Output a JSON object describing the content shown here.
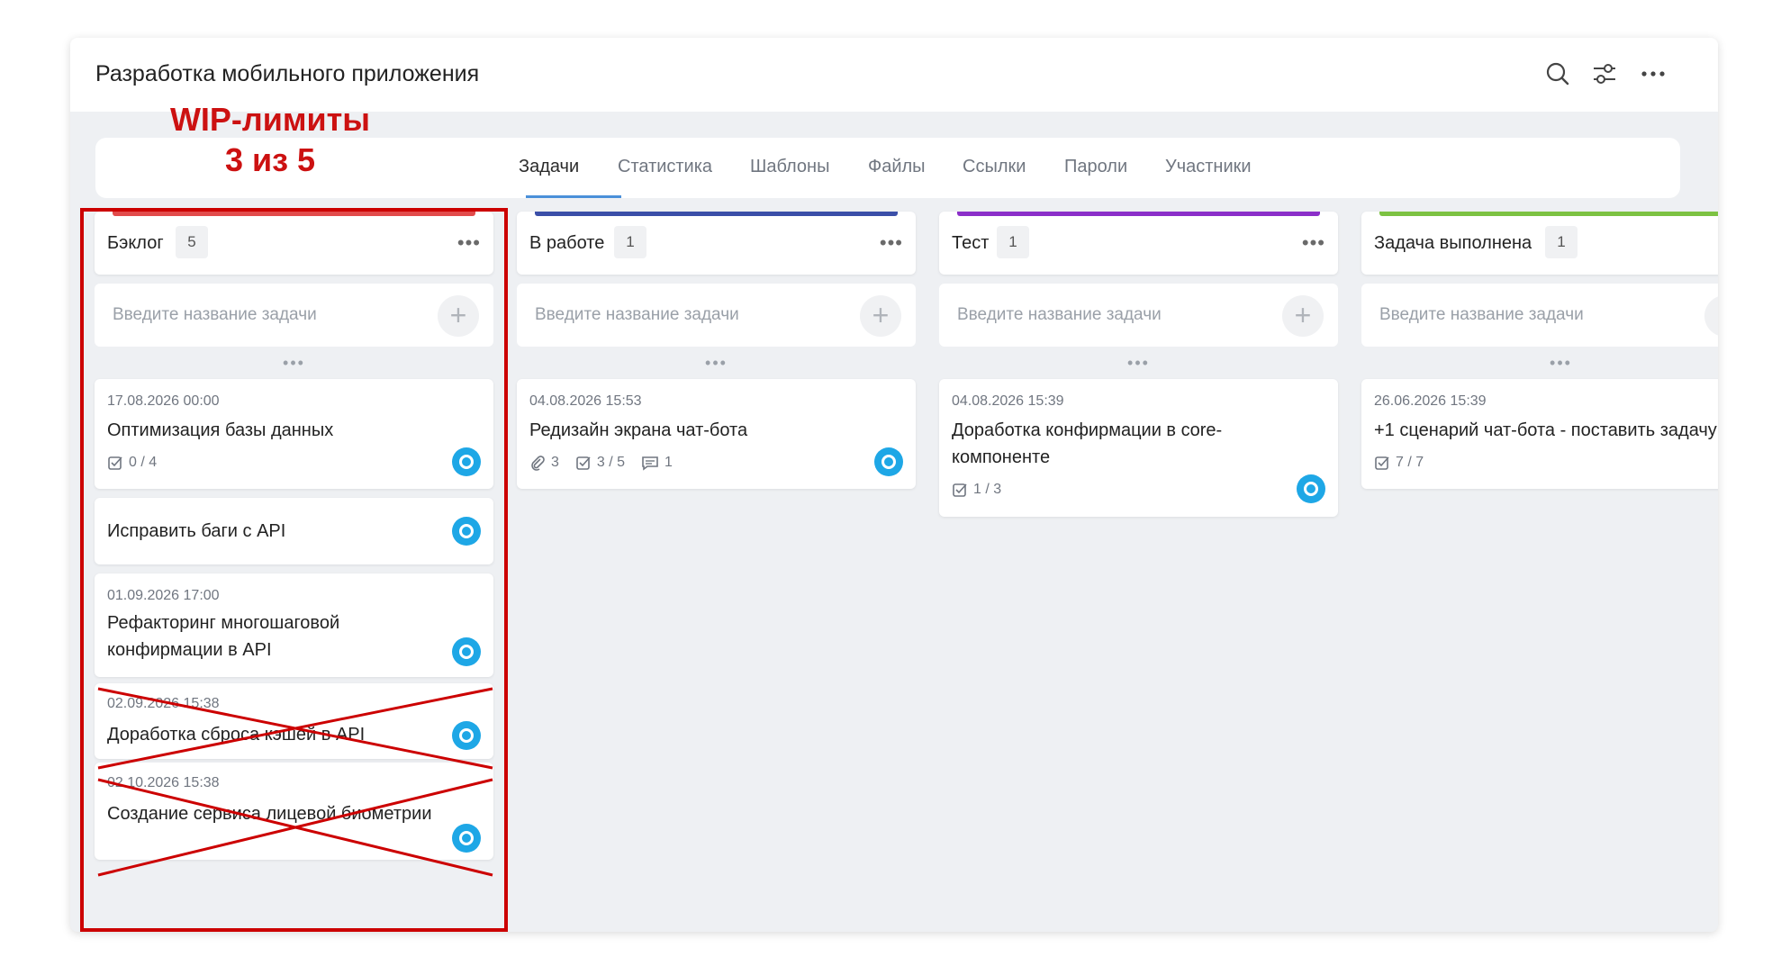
{
  "header": {
    "title": "Разработка мобильного приложения",
    "icons": [
      "search-icon",
      "filter-settings-icon",
      "more-icon"
    ]
  },
  "annotation": {
    "line1": "WIP-лимиты",
    "line2": "3 из 5",
    "color": "#cc0000"
  },
  "tabs": [
    {
      "label": "Задачи",
      "active": true
    },
    {
      "label": "Статистика"
    },
    {
      "label": "Шаблоны"
    },
    {
      "label": "Файлы"
    },
    {
      "label": "Ссылки"
    },
    {
      "label": "Пароли"
    },
    {
      "label": "Участники"
    }
  ],
  "new_task_placeholder": "Введите название задачи",
  "columns": [
    {
      "name": "Бэклог",
      "count": "5",
      "color": "#e24b4b",
      "cards": [
        {
          "date": "17.08.2026 00:00",
          "title": "Оптимизация базы данных",
          "checklist": "0 / 4"
        },
        {
          "title": "Исправить баги с API"
        },
        {
          "date": "01.09.2026 17:00",
          "title": "Рефакторинг многошаговой конфирмации в API"
        },
        {
          "date": "02.09.2026 15:38",
          "title": "Доработка сброса кэшей в API"
        },
        {
          "date": "02.10.2026 15:38",
          "title": "Создание сервиса лицевой биометрии"
        }
      ]
    },
    {
      "name": "В работе",
      "count": "1",
      "color": "#3b4fa8",
      "cards": [
        {
          "date": "04.08.2026 15:53",
          "title": "Редизайн экрана чат-бота",
          "attachments": "3",
          "checklist": "3 / 5",
          "comments": "1"
        }
      ]
    },
    {
      "name": "Тест",
      "count": "1",
      "color": "#8b2fc9",
      "cards": [
        {
          "date": "04.08.2026 15:39",
          "title": "Доработка конфирмации в core-компоненте",
          "checklist": "1 / 3"
        }
      ]
    },
    {
      "name": "Задача выполнена",
      "count": "1",
      "color": "#7cc242",
      "cards": [
        {
          "date": "26.06.2026 15:39",
          "title": "+1 сценарий чат-бота - поставить задачу",
          "checklist": "7 / 7"
        }
      ]
    }
  ]
}
